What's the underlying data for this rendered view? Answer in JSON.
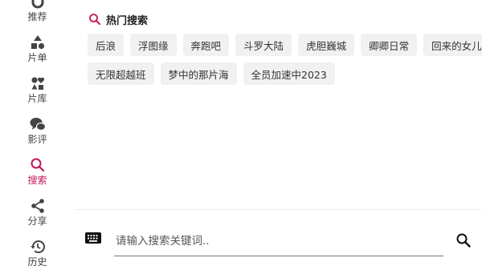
{
  "sidebar": {
    "items": [
      {
        "label": "推荐",
        "icon": "recommend-icon"
      },
      {
        "label": "片单",
        "icon": "shapes-icon"
      },
      {
        "label": "片库",
        "icon": "library-icon"
      },
      {
        "label": "影评",
        "icon": "chat-bubbles-icon"
      },
      {
        "label": "搜索",
        "icon": "search-icon",
        "active": true
      },
      {
        "label": "分享",
        "icon": "share-icon"
      },
      {
        "label": "历史",
        "icon": "history-icon"
      }
    ],
    "active_color": "#c2185b"
  },
  "hot_search": {
    "title": "热门搜索",
    "icon": "search-icon",
    "rows": [
      [
        "后浪",
        "浮图缘",
        "奔跑吧",
        "斗罗大陆",
        "虎胆巍城",
        "卿卿日常",
        "回来的女儿"
      ],
      [
        "无限超越班",
        "梦中的那片海",
        "全员加速中2023"
      ]
    ]
  },
  "search_bar": {
    "keyboard_icon": "keyboard-icon",
    "placeholder": "请输入搜索关键词..",
    "value": "",
    "submit_icon": "search-icon"
  }
}
